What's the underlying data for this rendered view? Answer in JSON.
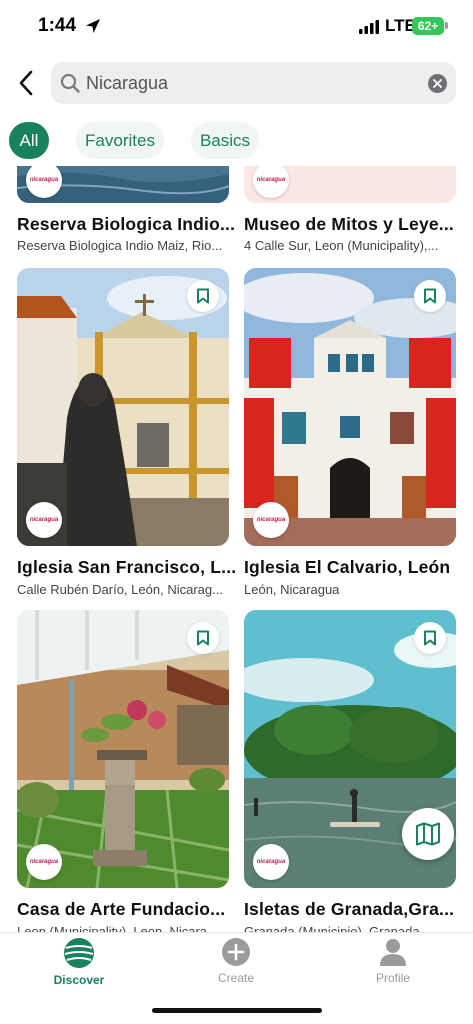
{
  "status": {
    "time": "1:44",
    "network": "LTE",
    "battery": "62+"
  },
  "search": {
    "value": "Nicaragua",
    "placeholder": "Search"
  },
  "filters": [
    "All",
    "Favorites",
    "Basics"
  ],
  "cards": [
    {
      "title": "Reserva Biologica Indio...",
      "subtitle": "Reserva Biologica Indio Maiz, Rio..."
    },
    {
      "title": "Museo de Mitos y Leye...",
      "subtitle": "4 Calle Sur, Leon (Municipality),..."
    },
    {
      "title": "Iglesia San Francisco, L...",
      "subtitle": "Calle Rubén Darío, León, Nicarag..."
    },
    {
      "title": "Iglesia El Calvario, León",
      "subtitle": "León, Nicaragua"
    },
    {
      "title": "Casa de Arte Fundacio...",
      "subtitle": "Leon (Municipality), Leon, Nicara..."
    },
    {
      "title": "Isletas de Granada,Gra...",
      "subtitle": "Granada (Municipio), Granada..."
    }
  ],
  "badge_text": "nicaragua",
  "tabs": [
    {
      "label": "Discover",
      "icon": "globe-icon",
      "active": true
    },
    {
      "label": "Create",
      "icon": "plus-circle-icon",
      "active": false
    },
    {
      "label": "Profile",
      "icon": "person-icon",
      "active": false
    }
  ],
  "colors": {
    "accent": "#19815c",
    "chip_inactive_bg": "#f1f6f3",
    "inactive_tab": "#9b9b9b"
  }
}
